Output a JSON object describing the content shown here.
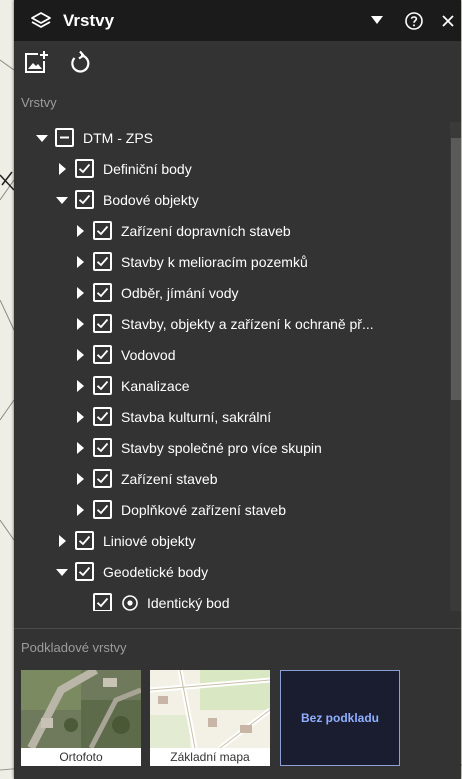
{
  "header": {
    "title": "Vrstvy",
    "icons": [
      "layers-icon",
      "chevron-down-icon",
      "help-icon",
      "close-icon"
    ]
  },
  "toolbar": {
    "icons": [
      "add-layer-icon",
      "refresh-icon"
    ]
  },
  "layers_section": {
    "label": "Vrstvy",
    "tree": [
      {
        "label": "DTM - ZPS",
        "level": 0,
        "expanded": true,
        "check": "partial"
      },
      {
        "label": "Definiční body",
        "level": 1,
        "expanded": false,
        "check": "checked"
      },
      {
        "label": "Bodové objekty",
        "level": 1,
        "expanded": true,
        "check": "checked"
      },
      {
        "label": "Zařízení dopravních staveb",
        "level": 2,
        "expanded": false,
        "check": "checked"
      },
      {
        "label": "Stavby k melioracím pozemků",
        "level": 2,
        "expanded": false,
        "check": "checked"
      },
      {
        "label": "Odběr, jímání vody",
        "level": 2,
        "expanded": false,
        "check": "checked"
      },
      {
        "label": "Stavby, objekty a zařízení k ochraně př...",
        "level": 2,
        "expanded": false,
        "check": "checked"
      },
      {
        "label": "Vodovod",
        "level": 2,
        "expanded": false,
        "check": "checked"
      },
      {
        "label": "Kanalizace",
        "level": 2,
        "expanded": false,
        "check": "checked"
      },
      {
        "label": "Stavba kulturní, sakrální",
        "level": 2,
        "expanded": false,
        "check": "checked"
      },
      {
        "label": "Stavby společné pro více skupin",
        "level": 2,
        "expanded": false,
        "check": "checked"
      },
      {
        "label": "Zařízení staveb",
        "level": 2,
        "expanded": false,
        "check": "checked"
      },
      {
        "label": "Doplňkové zařízení staveb",
        "level": 2,
        "expanded": false,
        "check": "checked"
      },
      {
        "label": "Liniové objekty",
        "level": 1,
        "expanded": false,
        "check": "checked"
      },
      {
        "label": "Geodetické body",
        "level": 1,
        "expanded": true,
        "check": "checked"
      },
      {
        "label": "Identický bod",
        "level": 2,
        "expanded": null,
        "check": "checked",
        "icon": "target-icon"
      }
    ]
  },
  "base_section": {
    "label": "Podkladové vrstvy",
    "tiles": [
      {
        "caption": "Ortofoto"
      },
      {
        "caption": "Základní mapa"
      },
      {
        "caption": "Bez podkladu",
        "selected": true
      }
    ]
  },
  "colors": {
    "panel_bg": "#333333",
    "header_bg": "#1b1b1b",
    "section_label": "#9c9c9c",
    "selected_tile_bg": "#1a1c30",
    "selected_tile_text": "#8fb0ff"
  }
}
